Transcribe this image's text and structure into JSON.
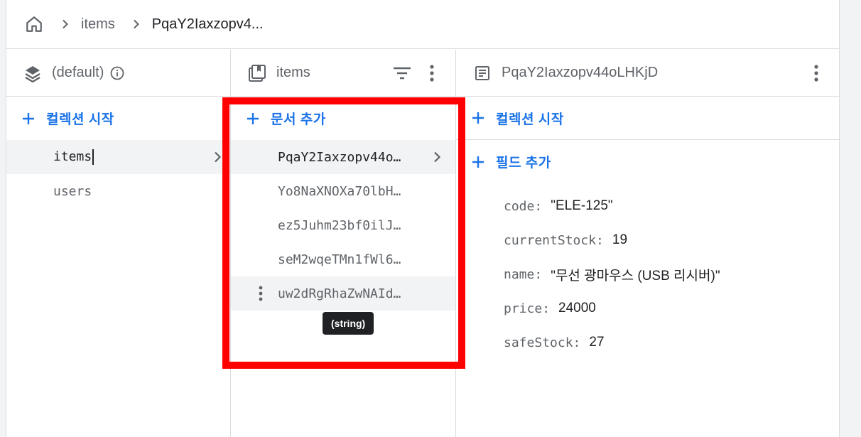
{
  "breadcrumb": {
    "home_icon": "home-icon",
    "items": [
      "items",
      "PqaY2Iaxzopv4..."
    ]
  },
  "columns": {
    "database": {
      "title": "(default)",
      "icon": "database-stack-icon",
      "start_collection_label": "컬렉션 시작",
      "collections": [
        "items",
        "users"
      ],
      "selected": "items"
    },
    "collection": {
      "title": "items",
      "icon": "collection-icon",
      "add_document_label": "문서 추가",
      "documents": [
        "PqaY2Iaxzopv44o…",
        "Yo8NaXNOXa70lbH…",
        "ez5Juhm23bf0ilJ…",
        "seM2wqeTMn1fWl6…",
        "uw2dRgRhaZwNAId…"
      ],
      "selected": "PqaY2Iaxzopv44o…",
      "hovered": "uw2dRgRhaZwNAId…",
      "tooltip": "(string)"
    },
    "document": {
      "title": "PqaY2Iaxzopv44oLHKjD",
      "icon": "document-icon",
      "start_collection_label": "컬렉션 시작",
      "add_field_label": "필드 추가",
      "fields": [
        {
          "key": "code",
          "value": "\"ELE-125\""
        },
        {
          "key": "currentStock",
          "value": "19"
        },
        {
          "key": "name",
          "value": "\"무선 광마우스 (USB 리시버)\""
        },
        {
          "key": "price",
          "value": "24000"
        },
        {
          "key": "safeStock",
          "value": "27"
        }
      ]
    }
  },
  "colors": {
    "accent": "#1a73e8",
    "highlight": "#ff0000",
    "selected_bg": "#f1f3f4",
    "border": "#dadce0"
  }
}
